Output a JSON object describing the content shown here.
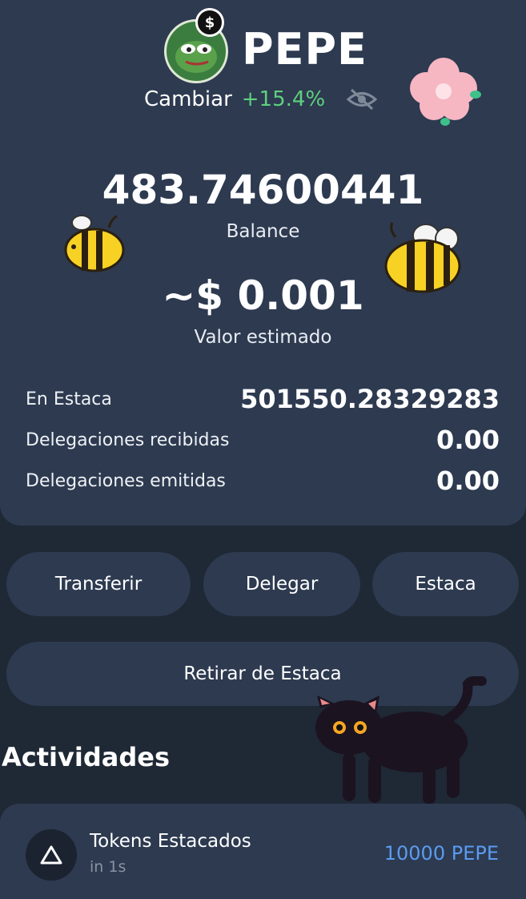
{
  "token": {
    "name": "PEPE",
    "change_label": "Cambiar",
    "change_value": "+15.4%"
  },
  "balance": {
    "amount": "483.74600441",
    "label": "Balance",
    "estimated": "~$ 0.001",
    "estimated_label": "Valor estimado"
  },
  "stats": [
    {
      "label": "En Estaca",
      "value": "501550.28329283"
    },
    {
      "label": "Delegaciones recibidas",
      "value": "0.00"
    },
    {
      "label": "Delegaciones emitidas",
      "value": "0.00"
    }
  ],
  "actions": {
    "transfer": "Transferir",
    "delegate": "Delegar",
    "stake": "Estaca",
    "unstake": "Retirar de Estaca"
  },
  "activities": {
    "title": "Actividades",
    "items": [
      {
        "title": "Tokens Estacados",
        "time": "in 1s",
        "amount": "10000 PEPE"
      }
    ]
  },
  "colors": {
    "card": "#2d3a50",
    "background": "#1f2835",
    "positive": "#5fd07e",
    "amount": "#5b9bf0"
  }
}
